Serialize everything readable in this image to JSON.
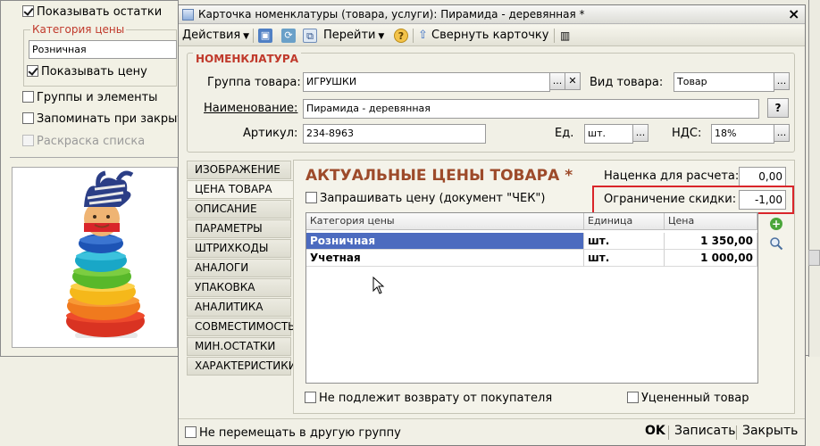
{
  "background_form": {
    "show_remainders_label": "Показывать остатки",
    "price_category_group_label": "Категория цены",
    "price_category_value": "Розничная",
    "show_price_label": "Показывать цену",
    "groups_and_elements_label": "Группы и элементы",
    "remember_label": "Запоминать при закрыт",
    "list_coloring_label": "Раскраска списка"
  },
  "window": {
    "title": "Карточка номенклатуры (товара, услуги): Пирамида - деревянная *",
    "close_glyph": "×"
  },
  "toolbar": {
    "actions_label": "Действия",
    "goto_label": "Перейти",
    "help_glyph": "?",
    "collapse_label": "Свернуть карточку"
  },
  "nomenclature": {
    "section_title": "НОМЕНКЛАТУРА",
    "product_group_label": "Группа товара:",
    "product_group_value": "ИГРУШКИ",
    "product_type_label": "Вид товара:",
    "product_type_value": "Товар",
    "name_label": "Наименование:",
    "name_value": "Пирамида - деревянная",
    "name_help_glyph": "?",
    "article_label": "Артикул:",
    "article_value": "234-8963",
    "unit_label": "Ед.",
    "unit_value": "шт.",
    "vat_label": "НДС:",
    "vat_value": "18%",
    "select_glyph": "...",
    "clear_glyph": "✕"
  },
  "tabs": [
    {
      "label": "ИЗОБРАЖЕНИЕ",
      "active": false
    },
    {
      "label": "ЦЕНА ТОВАРА",
      "active": true
    },
    {
      "label": "ОПИСАНИЕ",
      "active": false
    },
    {
      "label": "ПАРАМЕТРЫ",
      "active": false
    },
    {
      "label": "ШТРИХКОДЫ",
      "active": false
    },
    {
      "label": "АНАЛОГИ",
      "active": false
    },
    {
      "label": "УПАКОВКА",
      "active": false
    },
    {
      "label": "АНАЛИТИКА",
      "active": false
    },
    {
      "label": "СОВМЕСТИМОСТЬ",
      "active": false
    },
    {
      "label": "МИН.ОСТАТКИ",
      "active": false
    },
    {
      "label": "ХАРАКТЕРИСТИКИ",
      "active": false
    }
  ],
  "prices": {
    "heading": "АКТУАЛЬНЫЕ ЦЕНЫ ТОВАРА *",
    "markup_label": "Наценка для расчета:",
    "markup_value": "0,00",
    "ask_price_label": "Запрашивать цену (документ \"ЧЕК\")",
    "discount_limit_label": "Ограничение скидки:",
    "discount_limit_value": "-1,00",
    "highlight_color": "#d9252a",
    "columns": [
      "Категория цены",
      "Единица",
      "Цена"
    ],
    "rows": [
      {
        "category": "Розничная",
        "unit": "шт.",
        "price": "1 350,00",
        "selected": true
      },
      {
        "category": "Учетная",
        "unit": "шт.",
        "price": "1 000,00",
        "selected": false
      }
    ],
    "non_returnable_label": "Не подлежит возврату от покупателя",
    "discounted_label": "Уцененный товар"
  },
  "footer": {
    "dont_move_label": "Не перемещать в другую группу",
    "ok_label": "OK",
    "save_label": "Записать",
    "close_label": "Закрыть"
  },
  "colors": {
    "selected_row": "#4c6bbf",
    "section_title": "#c0392b",
    "heading": "#9d4a2a"
  }
}
